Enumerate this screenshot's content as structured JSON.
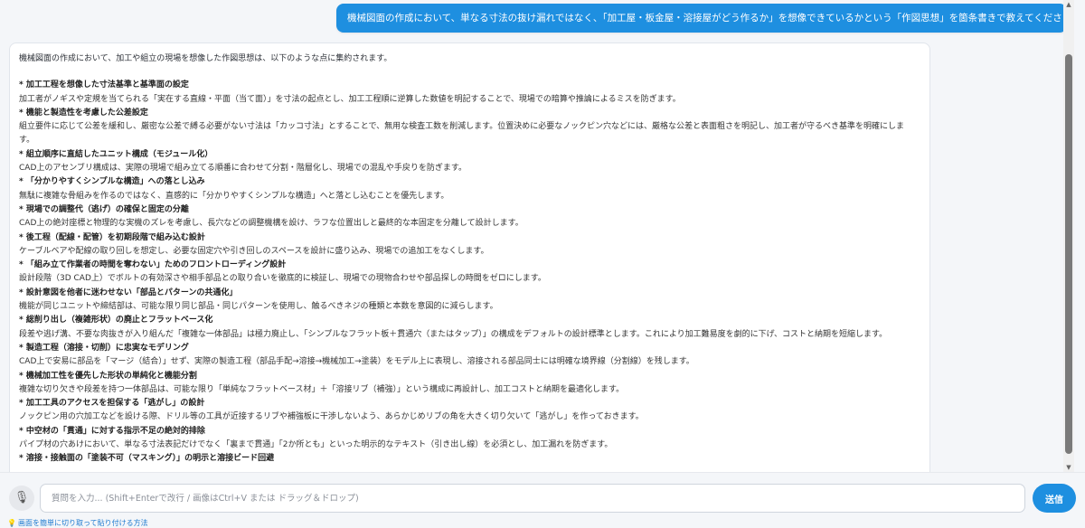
{
  "user_message": "機械図面の作成において、単なる寸法の抜け漏れではなく、「加工屋・板金屋・溶接屋がどう作るか」を想像できているかという「作図思想」を箇条書きで教えてください。",
  "answer": {
    "intro": "機械図面の作成において、加工や組立の現場を想像した作図思想は、以下のような点に集約されます。",
    "items": [
      {
        "title": "* 加工工程を想像した寸法基準と基準面の設定",
        "body": "加工者がノギスや定規を当てられる「実在する直線・平面（当て面）」を寸法の起点とし、加工工程順に逆算した数値を明記することで、現場での暗算や推論によるミスを防ぎます。"
      },
      {
        "title": "* 機能と製造性を考慮した公差設定",
        "body": "組立要件に応じて公差を緩和し、厳密な公差で縛る必要がない寸法は「カッコ寸法」とすることで、無用な検査工数を削減します。位置決めに必要なノックピン穴などには、厳格な公差と表面粗さを明記し、加工者が守るべき基準を明確にします。"
      },
      {
        "title": "* 組立順序に直結したユニット構成（モジュール化）",
        "body": "CAD上のアセンブリ構成は、実際の現場で組み立てる順番に合わせて分割・階層化し、現場での混乱や手戻りを防ぎます。"
      },
      {
        "title": "* 「分かりやすくシンプルな構造」への落とし込み",
        "body": "無駄に複雑な骨組みを作るのではなく、直感的に「分かりやすくシンプルな構造」へと落とし込むことを優先します。"
      },
      {
        "title": "* 現場での調整代（逃げ）の確保と固定の分離",
        "body": "CAD上の絶対座標と物理的な実機のズレを考慮し、長穴などの調整機構を設け、ラフな位置出しと最終的な本固定を分離して設計します。"
      },
      {
        "title": "* 後工程（配線・配管）を初期段階で組み込む設計",
        "body": "ケーブルベアや配線の取り回しを想定し、必要な固定穴や引き回しのスペースを設計に盛り込み、現場での追加工をなくします。"
      },
      {
        "title": "* 「組み立て作業者の時間を奪わない」ためのフロントローディング設計",
        "body": "設計段階（3D CAD上）でボルトの有効深さや相手部品との取り合いを徹底的に検証し、現場での現物合わせや部品探しの時間をゼロにします。"
      },
      {
        "title": "* 設計意図を他者に迷わせない「部品とパターンの共通化」",
        "body": "機能が同じユニットや締結部は、可能な限り同じ部品・同じパターンを使用し、触るべきネジの種類と本数を意図的に減らします。"
      },
      {
        "title": "* 総削り出し（複雑形状）の廃止とフラットベース化",
        "body": "段差や逃げ溝、不要な肉抜きが入り組んだ「複雑な一体部品」は極力廃止し、「シンプルなフラット板＋貫通穴（またはタップ）」の構成をデフォルトの設計標準とします。これにより加工難易度を劇的に下げ、コストと納期を短縮します。"
      },
      {
        "title": "* 製造工程（溶接・切削）に忠実なモデリング",
        "body": "CAD上で安易に部品を「マージ（結合）」せず、実際の製造工程（部品手配→溶接→機械加工→塗装）をモデル上に表現し、溶接される部品同士には明確な境界線（分割線）を残します。"
      },
      {
        "title": "* 機械加工性を優先した形状の単純化と機能分割",
        "body": "複雑な切り欠きや段差を持つ一体部品は、可能な限り「単純なフラットベース材」＋「溶接リブ（補強）」という構成に再設計し、加工コストと納期を最適化します。"
      },
      {
        "title": "* 加工工具のアクセスを担保する「逃がし」の設計",
        "body": "ノックピン用の穴加工などを設ける際、ドリル等の工具が近接するリブや補強板に干渉しないよう、あらかじめリブの角を大きく切り欠いて「逃がし」を作っておきます。"
      },
      {
        "title": "* 中空材の「貫通」に対する指示不足の絶対的排除",
        "body": "パイプ材の穴あけにおいて、単なる寸法表記だけでなく「裏まで貫通」「2か所とも」といった明示的なテキスト（引き出し線）を必須とし、加工漏れを防ぎます。"
      },
      {
        "title": "* 溶接・接触面の「塗装不可（マスキング）」の明示と溶接ビード回避",
        "body": ""
      }
    ]
  },
  "input": {
    "placeholder": "質問を入力... (Shift+Enterで改行 / 画像はCtrl+V または ドラッグ＆ドロップ)",
    "value": ""
  },
  "send_label": "送信",
  "tip_text": "画面を簡単に切り取って貼り付ける方法"
}
